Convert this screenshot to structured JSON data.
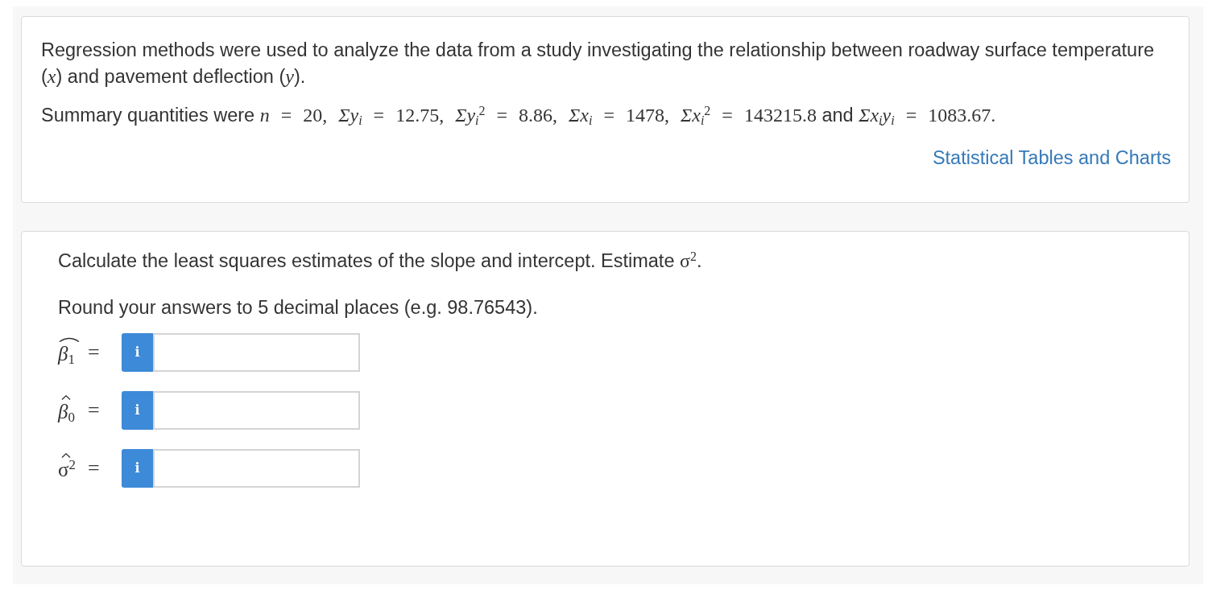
{
  "problem": {
    "statement": [
      {
        "kind": "text",
        "text": "Regression methods were used to analyze the data from a study investigating the relationship between roadway surface temperature ("
      },
      {
        "kind": "math",
        "text": "*x*"
      },
      {
        "kind": "text",
        "text": ") and pavement deflection ("
      },
      {
        "kind": "math",
        "text": "*y*"
      },
      {
        "kind": "text",
        "text": ")."
      }
    ],
    "summary": [
      {
        "kind": "text",
        "text": "Summary quantities were "
      },
      {
        "kind": "math",
        "text": "*n* = 20, *Σy*$_{i}$ = 12.75, *Σy*$_{i}$$^{2}$ = 8.86, *Σx*$_{i}$ = 1478, *Σx*$_{i}$$^{2}$ = 143215.8"
      },
      {
        "kind": "text",
        "text": " and "
      },
      {
        "kind": "math",
        "text": "*Σx*$_{i}$*y*$_{i}$ = 1083.67."
      }
    ],
    "link": "Statistical Tables and Charts"
  },
  "question": {
    "prompt": [
      {
        "kind": "text",
        "text": "Calculate the least squares estimates of the slope and intercept. Estimate "
      },
      {
        "kind": "math",
        "text": "σ$^{2}$"
      },
      {
        "kind": "text",
        "text": "."
      }
    ],
    "instruction": "Round your answers to 5 decimal places (e.g. 98.76543).",
    "answers": [
      {
        "label": "*β*$_{1}$",
        "wide_hat": true,
        "relation": "=",
        "button": "i"
      },
      {
        "label": "*β*$_{0}$",
        "wide_hat": false,
        "relation": "=",
        "button": "i"
      },
      {
        "label": "σ$^{2}$",
        "wide_hat": false,
        "relation": "=",
        "button": "i"
      }
    ]
  }
}
